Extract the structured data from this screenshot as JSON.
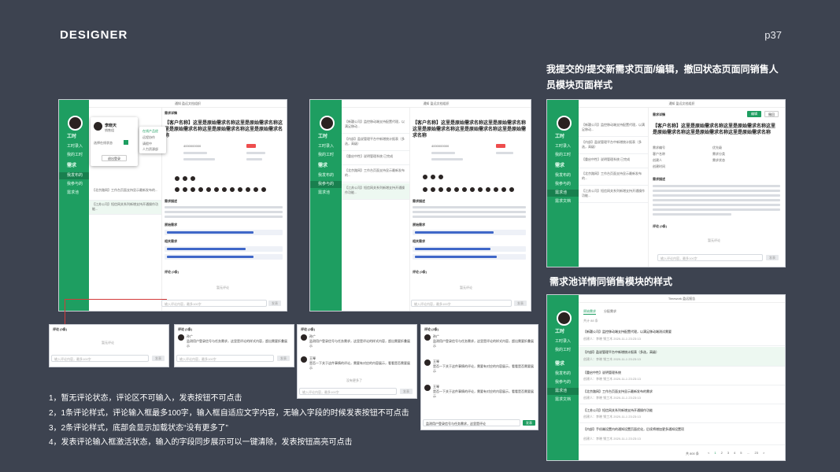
{
  "brand": "DESIGNER",
  "page_number": "p37",
  "headings": {
    "top_right": "我提交的/提交新需求页面/编辑，撤回状态页面同销售人员模块页面样式",
    "pool": "需求池详情同销售模块的样式"
  },
  "notes": [
    "1，暂无评论状态，评论区不可输入，发表按钮不可点击",
    "2，1条评论样式，评论输入框最多100字，输入框自适应文字内容，无输入字段的时候发表按钮不可点击",
    "3，2条评论样式，底部会显示加载状态“没有更多了”",
    "4，发表评论输入框激活状态，输入的字段同步展示可以一键清除，发表按钮高亮可点击"
  ],
  "window_title": "通知 盈远文档组织",
  "sidebar": {
    "work": "工时",
    "work_items": [
      "工时录入",
      "我的工时"
    ],
    "demand": "需求",
    "demand_items": [
      "我发布的",
      "我参与的",
      "需求池"
    ],
    "demand_items_alt": [
      "我发布的",
      "我参与的",
      "需求池",
      "需求文档"
    ]
  },
  "profile_popup": {
    "name": "李晓天",
    "role": "销售组",
    "status_label": "选择在线状态",
    "options": [
      "在线产品经",
      "远程协作",
      "请假中",
      "人力资源部"
    ],
    "button": "退出登录"
  },
  "detail": {
    "header": "需求详情",
    "title": "【客户名称】这里是原始需求名称这里是原始需求名称这里是原始需求名称这里是原始需求名称这里是原始需求名称",
    "section_desc": "需求描述",
    "section_attach": "原始需求",
    "section_related": "相关需求",
    "comments_label": "评论 (0条)",
    "no_comments": "暂无评论",
    "input_placeholder": "输入评论内容，最多100字",
    "counter": "0/100",
    "send": "发表",
    "edit": "编辑",
    "withdraw": "撤回",
    "fields": [
      {
        "k": "需求编号",
        "v": "4000000000"
      },
      {
        "k": "客户名称",
        "v": "伊利集团"
      },
      {
        "k": "需求来源",
        "v": "平台需求"
      },
      {
        "k": "所属产品",
        "v": "Android APP、服务端"
      },
      {
        "k": "创建人",
        "v": "李晓"
      },
      {
        "k": "创建时间",
        "v": "2021-1-1 9:45"
      }
    ],
    "fields_right": [
      {
        "k": "优先级",
        "v": "紧急"
      },
      {
        "k": "需求分类",
        "v": "功能需求"
      },
      {
        "k": "需求状态",
        "v": "待评估"
      },
      {
        "k": "预计工时",
        "v": "8h"
      }
    ]
  },
  "list_items": [
    "【新疆公司】监控移动端支持配置代理，以满足移动...",
    "【内部】盈说管理平台中新增统计报表（多选，高级）",
    "【重启中性】说明管理系统 已完成",
    "【北京路网】工作台页面支持显示最新发布的...",
    "【江苏公司】短信网关系列新增支持开通操作功能..."
  ],
  "list_extra": [
    "【客户名称】说明文档需求 已完成",
    "【内部】监控手机端文档事项（需求整体优化）"
  ],
  "comments": {
    "label_one": "评论 (1条)",
    "label_two": "评论 (2条)",
    "user1": "孙广",
    "user2": "王琴",
    "text1": "监测用户登录信号与任务需求，这里是评论的样式内容，超出需要折叠展示",
    "text2": "是否一下关于这件事情的评论，需要有对应的内容展示，看看是否需要展示",
    "time": "2020-11-1 9:30",
    "no_more": "没有更多了",
    "typing": "监测用户登录信号与任务需求，这里是评论"
  },
  "pool_window": {
    "title": "Timework 盈远报告",
    "tabs": [
      "原始需求",
      "分配需求"
    ],
    "count": "共计 88 条",
    "pagination": [
      "<",
      "1",
      "2",
      "3",
      "4",
      "5",
      "…",
      "23",
      ">"
    ],
    "total": "共 800 条",
    "items": [
      {
        "t": "【新疆公司】监控移动端支持配置代理，以满足移动端测试需要",
        "m": "创建人：李晓  销工木  2020-11-1 23:23:13"
      },
      {
        "t": "【内部】盈说管理平台中新增统计报表（多选，高级）",
        "m": "创建人：李晓  销工木  2020-11-1 23:23:13"
      },
      {
        "t": "【重启中性】说明管理系统",
        "m": "创建人：李晓  销工木  2020-11-1 23:23:13"
      },
      {
        "t": "【北京路网】工作台页面支持显示最新发布的需求",
        "m": "创建人：李晓  销工木  2020-11-1 23:23:13"
      },
      {
        "t": "【江苏公司】短信网关系列新增支持开通操作功能",
        "m": "创建人：李晓  销工木  2020-11-1 23:23:13"
      },
      {
        "t": "【内部】手机端设置内的通知设置页面优化，后续将增加更多通知设置项",
        "m": "创建人：李晓  销工木  2020-11-1 23:23:13"
      }
    ]
  },
  "colors": {
    "background": "#3d4350",
    "accent": "#1e9e61",
    "danger": "#ee4d4d",
    "link": "#3f67c8"
  }
}
